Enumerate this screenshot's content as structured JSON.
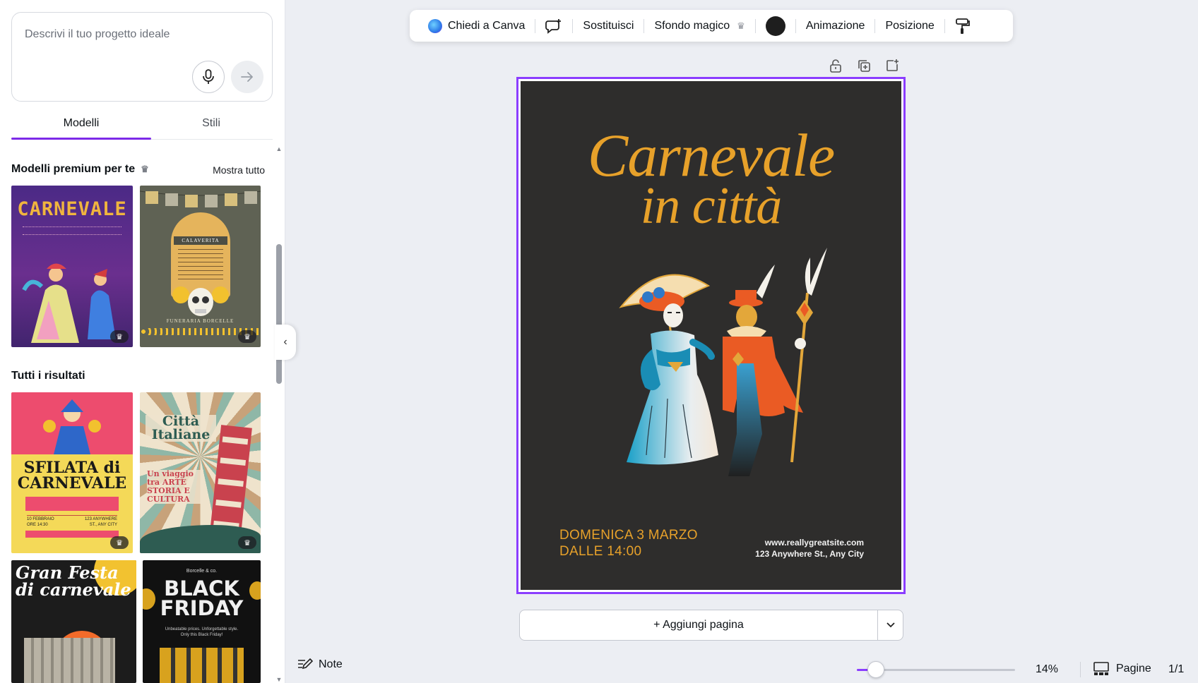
{
  "left_panel": {
    "prompt_placeholder": "Descrivi il tuo progetto ideale",
    "tabs": [
      {
        "label": "Modelli",
        "active": true
      },
      {
        "label": "Stili",
        "active": false
      }
    ],
    "premium_section": {
      "title": "Modelli premium per te",
      "show_all": "Mostra tutto"
    },
    "results_section": {
      "title": "Tutti i risultati"
    },
    "templates": [
      {
        "title": "CARNEVALE",
        "colors": [
          "#5a2a8c",
          "#e3a73a"
        ],
        "premium": true
      },
      {
        "title": "CALAVERITA",
        "footer": "FUNERARIA BORCELLE",
        "colors": [
          "#5c5f52",
          "#e9b456"
        ],
        "premium": true
      },
      {
        "title": "SFILATA di CARNEVALE",
        "colors": [
          "#f4d958",
          "#e9426b"
        ],
        "premium": true,
        "dates": [
          "10 FEBBRAIO",
          "ORE 14:30"
        ],
        "address": [
          "123 ANYWHERE",
          "ST., ANY CITY"
        ]
      },
      {
        "title": "Città Italiane",
        "subtitle": "Un viaggio tra ARTE STORIA E CULTURA",
        "colors": [
          "#efe3cc",
          "#c9424e"
        ],
        "premium": true
      },
      {
        "title": "Gran Festa di carnevale",
        "colors": [
          "#1c1c1c",
          "#f2c230"
        ],
        "premium": false
      },
      {
        "title": "BLACK FRIDAY",
        "brand": "Borcelle & co.",
        "subtitle": "Unbeatable prices. Unforgettable style. Only this Black Friday!",
        "colors": [
          "#111111",
          "#d8a21e"
        ],
        "premium": false
      }
    ]
  },
  "toolbar": {
    "ask_canva": "Chiedi a Canva",
    "replace": "Sostituisci",
    "magic_background": "Sfondo magico",
    "animation": "Animazione",
    "position": "Posizione",
    "color_swatch": "#1e1e1e"
  },
  "poster": {
    "title_line1": "Carnevale",
    "title_line2": "in città",
    "date_line1": "DOMENICA 3 MARZO",
    "date_line2": "DALLE 14:00",
    "website": "www.reallygreatsite.com",
    "address": "123 Anywhere St., Any City",
    "background": "#2e2d2c",
    "accent": "#e7a12a"
  },
  "canvas": {
    "add_page": "+ Aggiungi pagina"
  },
  "bottom_bar": {
    "notes": "Note",
    "zoom_value": "14%",
    "zoom_level": 0.12,
    "pages_label": "Pagine",
    "page_count": "1/1"
  },
  "colors": {
    "accent_purple": "#8b3dff",
    "tab_underline": "#7d2ae8"
  }
}
